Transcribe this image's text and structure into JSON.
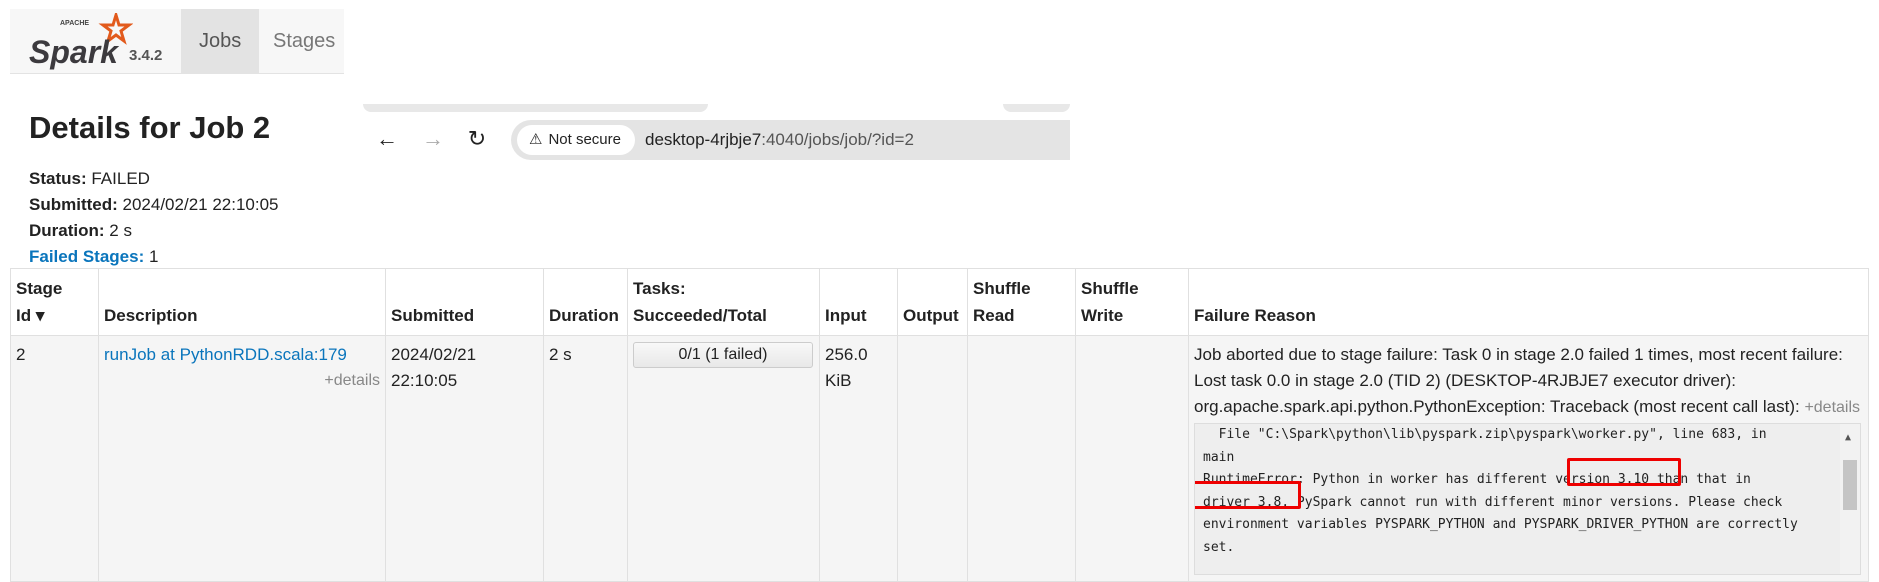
{
  "navbar": {
    "brand_small": "APACHE",
    "brand": "Spark",
    "version": "3.4.2",
    "tabs": [
      {
        "label": "Jobs",
        "active": true
      },
      {
        "label": "Stages",
        "active": false
      }
    ]
  },
  "browser": {
    "security": "Not secure",
    "url_host": "desktop-4rjbje7",
    "url_rest": ":4040/jobs/job/?id=2"
  },
  "page": {
    "title": "Details for Job 2",
    "status_label": "Status:",
    "status_value": "FAILED",
    "submitted_label": "Submitted:",
    "submitted_value": "2024/02/21 22:10:05",
    "duration_label": "Duration:",
    "duration_value": "2 s",
    "failed_stages_label": "Failed Stages:",
    "failed_stages_value": "1"
  },
  "table": {
    "headers": {
      "stage_id_1": "Stage",
      "stage_id_2": "Id ▾",
      "description": "Description",
      "submitted": "Submitted",
      "duration": "Duration",
      "tasks_1": "Tasks:",
      "tasks_2": "Succeeded/Total",
      "input": "Input",
      "output": "Output",
      "shuffle_read_1": "Shuffle",
      "shuffle_read_2": "Read",
      "shuffle_write_1": "Shuffle",
      "shuffle_write_2": "Write",
      "failure_reason": "Failure Reason"
    },
    "row": {
      "stage_id": "2",
      "description": "runJob at PythonRDD.scala:179",
      "details": "+details",
      "submitted_date": "2024/02/21",
      "submitted_time": "22:10:05",
      "duration": "2 s",
      "tasks": "0/1 (1 failed)",
      "tasks_progress": 0,
      "input_1": "256.0",
      "input_2": "KiB",
      "failure_line1": "Job aborted due to stage failure: Task 0 in stage 2.0 failed 1 times, most recent failure:",
      "failure_line2": "Lost task 0.0 in stage 2.0 (TID 2) (DESKTOP-4RJBJE7 executor driver):",
      "failure_line3": "org.apache.spark.api.python.PythonException: Traceback (most recent call last):",
      "failure_details": "+details",
      "trace": [
        "  File \"C:\\Spark\\python\\lib\\pyspark.zip\\pyspark\\worker.py\", line 683, in",
        "main",
        "RuntimeError: Python in worker has different version 3.10 than that in",
        "driver 3.8, PySpark cannot run with different minor versions. Please check",
        "environment variables PYSPARK_PYTHON and PYSPARK_DRIVER_PYTHON are correctly",
        "set."
      ]
    }
  },
  "colors": {
    "link": "#0a75bc",
    "highlight": "#e00000",
    "spark_orange": "#e25a1c"
  }
}
